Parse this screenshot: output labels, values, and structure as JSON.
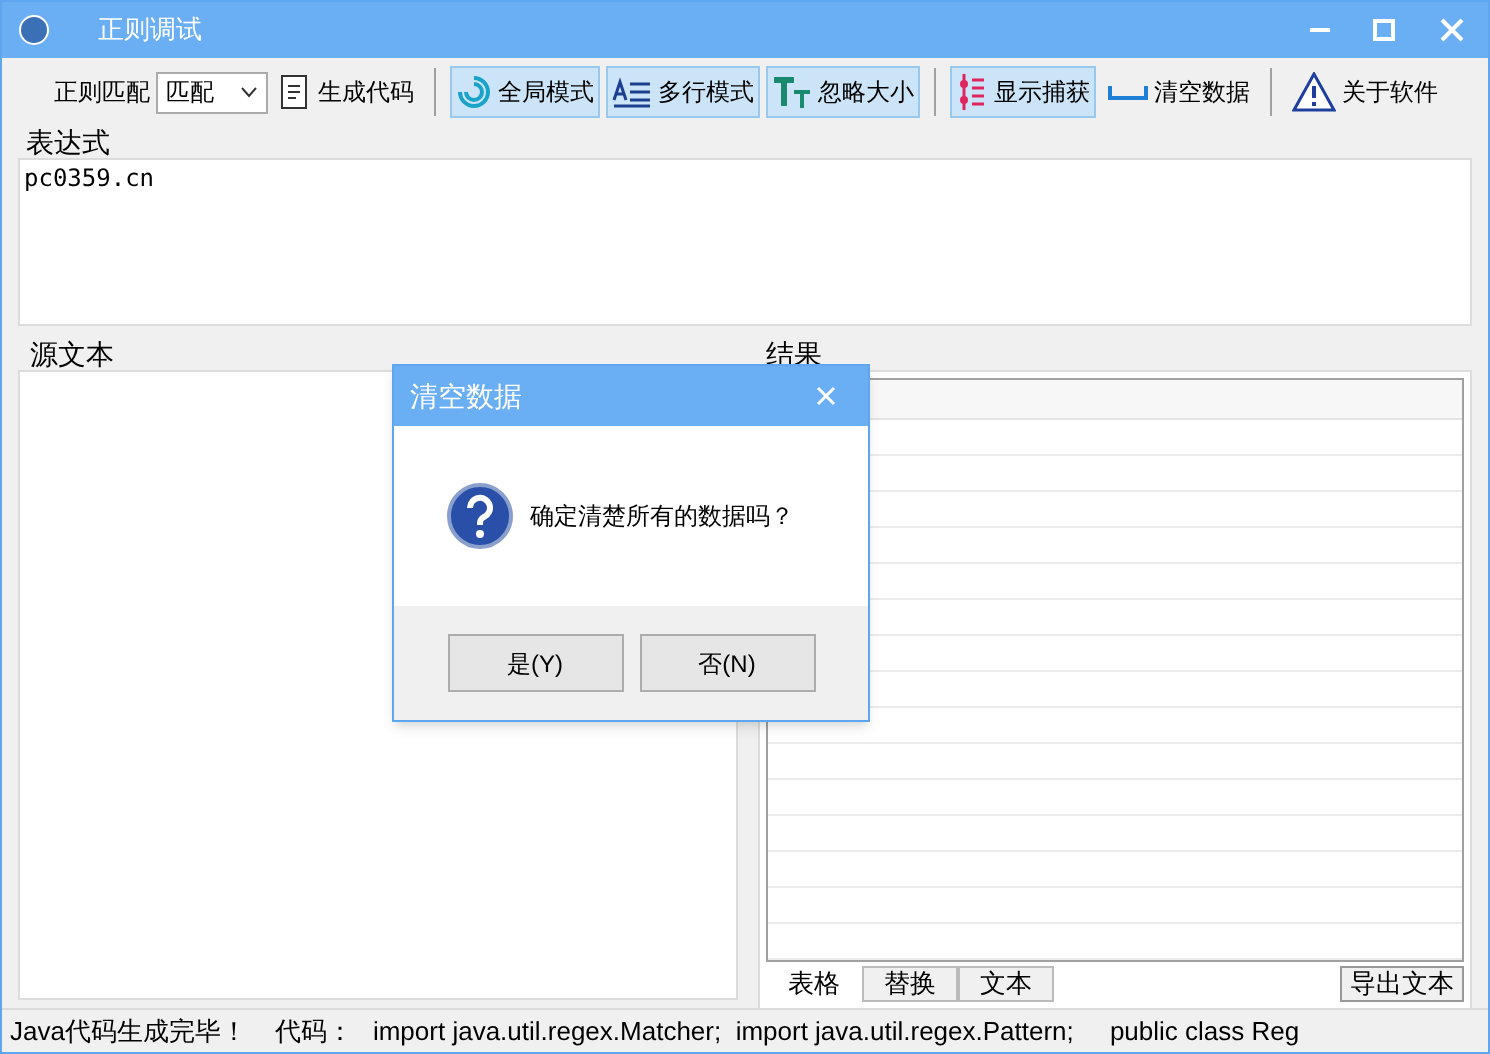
{
  "window": {
    "title": "正则调试"
  },
  "toolbar": {
    "match_label": "正则匹配",
    "match_mode": {
      "value": "匹配"
    },
    "items": [
      {
        "kind": "button",
        "label": "生成代码"
      },
      {
        "kind": "separator"
      },
      {
        "kind": "toggle",
        "label": "全局模式",
        "selected": true
      },
      {
        "kind": "toggle",
        "label": "多行模式",
        "selected": true
      },
      {
        "kind": "toggle",
        "label": "忽略大小",
        "selected": true
      },
      {
        "kind": "separator"
      },
      {
        "kind": "toggle",
        "label": "显示捕获",
        "selected": true
      },
      {
        "kind": "button",
        "label": "清空数据"
      },
      {
        "kind": "separator"
      },
      {
        "kind": "button",
        "label": "关于软件"
      }
    ]
  },
  "expression": {
    "label": "表达式",
    "value": "pc0359.cn"
  },
  "source": {
    "label": "源文本"
  },
  "results": {
    "label": "结果",
    "tabs": [
      {
        "label": "表格",
        "selected": true
      },
      {
        "label": "替换",
        "selected": false
      },
      {
        "label": "文本",
        "selected": false
      }
    ],
    "export_button": "导出文本"
  },
  "status_bar": {
    "message": "Java代码生成完毕！",
    "code_label": "代码：",
    "code": "import java.util.regex.Matcher;  import java.util.regex.Pattern;     public class Reg"
  },
  "dialog": {
    "title": "清空数据",
    "message": "确定清楚所有的数据吗？",
    "buttons": [
      {
        "label": "是(Y)"
      },
      {
        "label": "否(N)"
      }
    ]
  }
}
